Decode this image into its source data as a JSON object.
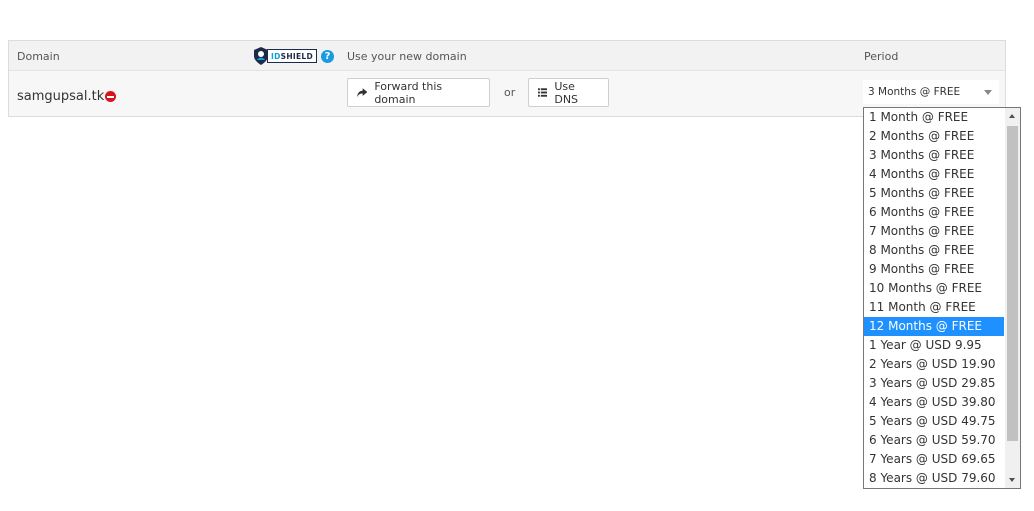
{
  "table": {
    "headers": {
      "domain": "Domain",
      "use_new_domain": "Use your new domain",
      "period": "Period"
    },
    "idshield_logo": {
      "part_a": "ID",
      "part_b": "SHIELD"
    },
    "help_icon_glyph": "?",
    "row": {
      "domain": "samgupsal.tk",
      "forward_button": "Forward this domain",
      "or_text": "or",
      "dns_button": "Use DNS",
      "period_selected": "3 Months @ FREE"
    }
  },
  "period_dropdown": {
    "highlighted_index": 11,
    "options": [
      "1 Month @ FREE",
      "2 Months @ FREE",
      "3 Months @ FREE",
      "4 Months @ FREE",
      "5 Months @ FREE",
      "6 Months @ FREE",
      "7 Months @ FREE",
      "8 Months @ FREE",
      "9 Months @ FREE",
      "10 Months @ FREE",
      "11 Month @ FREE",
      "12 Months @ FREE",
      "1 Year @ USD 9.95",
      "2 Years @ USD 19.90",
      "3 Years @ USD 29.85",
      "4 Years @ USD 39.80",
      "5 Years @ USD 49.75",
      "6 Years @ USD 59.70",
      "7 Years @ USD 69.65",
      "8 Years @ USD 79.60"
    ]
  },
  "colors": {
    "accent": "#1e90ff",
    "help_blue": "#1a9ae0",
    "remove_red": "#d9131d",
    "idshield_navy": "#1d2b4a"
  },
  "icons": {
    "forward": "share-forward-icon",
    "dns": "list-icon",
    "remove": "minus-circle-icon",
    "help": "question-circle-icon",
    "idshield": "shield-icon"
  }
}
